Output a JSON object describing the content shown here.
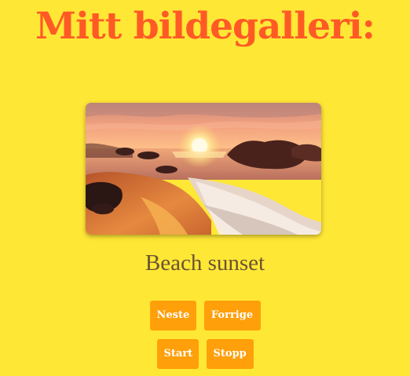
{
  "header": {
    "title": "Mitt bildegalleri:"
  },
  "gallery": {
    "image_name": "beach-sunset-photo",
    "caption": "Beach sunset"
  },
  "controls": {
    "next_label": "Neste",
    "previous_label": "Forrige",
    "start_label": "Start",
    "stop_label": "Stopp"
  },
  "colors": {
    "background": "#ffe736",
    "title": "#ff5a25",
    "caption": "#6b5331",
    "button": "#ff9f0a",
    "button_text": "#ffffff"
  }
}
